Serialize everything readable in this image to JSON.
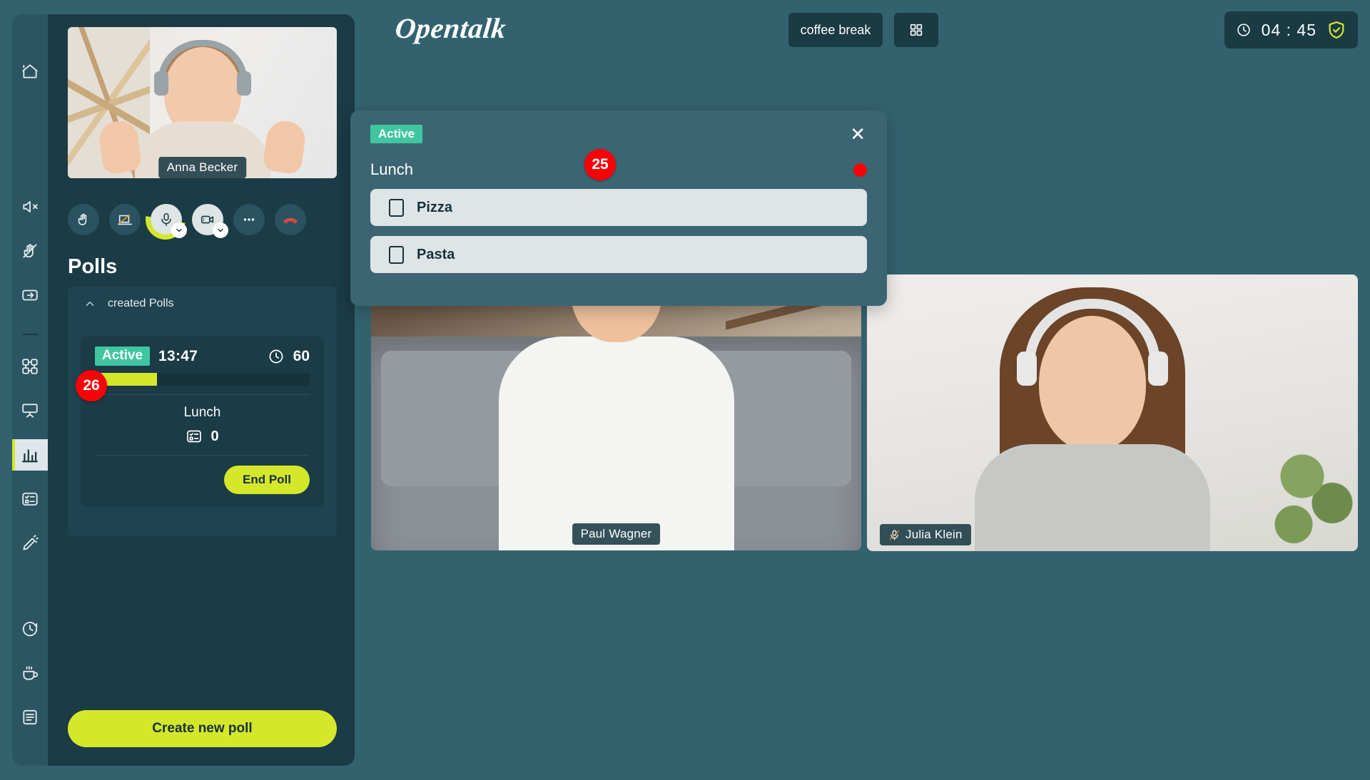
{
  "header": {
    "logo_text": "Opentalk",
    "coffee_break_label": "coffee break",
    "grid_icon": "grid-icon",
    "timer": "04 : 45",
    "clock_icon": "clock-icon",
    "shield_icon": "shield-check-icon"
  },
  "sidebar": {
    "items": [
      {
        "name": "home",
        "icon": "home-icon"
      },
      {
        "name": "mute-all",
        "icon": "speaker-muted-icon"
      },
      {
        "name": "lower-hands",
        "icon": "hand-lowered-icon"
      },
      {
        "name": "exit",
        "icon": "exit-icon"
      },
      {
        "name": "breakout",
        "icon": "grid-nodes-icon"
      },
      {
        "name": "whiteboard",
        "icon": "presentation-icon"
      },
      {
        "name": "polls",
        "icon": "bar-chart-icon",
        "active": true
      },
      {
        "name": "legal-vote",
        "icon": "form-checklist-icon"
      },
      {
        "name": "protocol",
        "icon": "pencil-icon"
      },
      {
        "name": "timer",
        "icon": "timer-icon"
      },
      {
        "name": "coffee-break",
        "icon": "coffee-cup-icon"
      },
      {
        "name": "chat",
        "icon": "text-lines-icon"
      }
    ]
  },
  "self_view": {
    "participant_name": "Anna Becker",
    "controls": [
      {
        "name": "raise-hand",
        "icon": "hand-icon",
        "style": "dark"
      },
      {
        "name": "share-screen",
        "icon": "screen-share-off-icon",
        "style": "dark"
      },
      {
        "name": "microphone",
        "icon": "microphone-icon",
        "style": "light",
        "has_caret": true,
        "has_level_ring": true
      },
      {
        "name": "camera",
        "icon": "video-camera-icon",
        "style": "light",
        "has_caret": true
      },
      {
        "name": "more-options",
        "icon": "ellipsis-icon",
        "style": "dark"
      },
      {
        "name": "hang-up",
        "icon": "phone-hangup-icon",
        "style": "dark"
      }
    ]
  },
  "polls_panel": {
    "title": "Polls",
    "accordion_label": "created Polls",
    "create_button_label": "Create new poll",
    "badge_count": "26",
    "poll": {
      "status": "Active",
      "time_remaining": "13:47",
      "duration": "60",
      "progress_percent": 29,
      "subject": "Lunch",
      "votes_count": "0",
      "votes_icon": "form-checklist-icon",
      "clock_icon": "clock-icon",
      "end_button_label": "End Poll"
    }
  },
  "modal": {
    "status": "Active",
    "question": "Lunch",
    "badge_count": "25",
    "close_icon": "close-icon",
    "recording_dot": "live-indicator",
    "options": [
      {
        "label": "Pizza"
      },
      {
        "label": "Pasta"
      }
    ]
  },
  "videos": [
    {
      "name": "Paul Wagner",
      "muted": false
    },
    {
      "name": "Julia Klein",
      "muted": true,
      "mic_icon": "microphone-muted-icon"
    }
  ],
  "colors": {
    "app_bg": "#33626f",
    "panel_bg": "#1b3b46",
    "rail_bg": "#2c5563",
    "accent_lime": "#d4e72b",
    "accent_teal": "#3fc6a0",
    "danger_red": "#fb0007",
    "modal_bg": "#3c6573"
  }
}
